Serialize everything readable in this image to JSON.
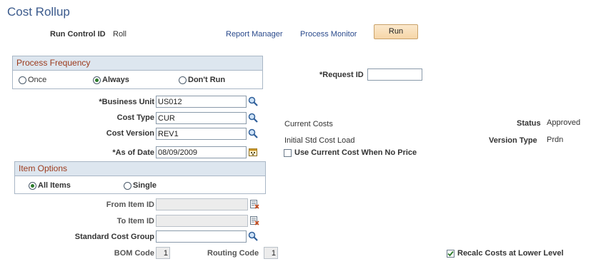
{
  "page": {
    "title": "Cost Rollup"
  },
  "header": {
    "run_control_label": "Run Control ID",
    "run_control_value": "Roll",
    "report_manager": "Report Manager",
    "process_monitor": "Process Monitor",
    "run_button": "Run"
  },
  "process_frequency": {
    "title": "Process Frequency",
    "options": [
      "Once",
      "Always",
      "Don't Run"
    ],
    "selected": "Always"
  },
  "request": {
    "label": "*Request ID",
    "value": ""
  },
  "fields": {
    "business_unit": {
      "label": "*Business Unit",
      "value": "US012"
    },
    "cost_type": {
      "label": "Cost Type",
      "value": "CUR",
      "desc": "Current Costs"
    },
    "cost_version": {
      "label": "Cost Version",
      "value": "REV1",
      "desc": "Initial Std Cost Load"
    },
    "as_of_date": {
      "label": "*As of Date",
      "value": "08/09/2009"
    }
  },
  "status": {
    "label": "Status",
    "value": "Approved"
  },
  "version_type": {
    "label": "Version Type",
    "value": "Prdn"
  },
  "use_current_cost": {
    "label": "Use Current Cost When No Price",
    "checked": false
  },
  "item_options": {
    "title": "Item Options",
    "options": [
      "All Items",
      "Single"
    ],
    "selected": "All Items"
  },
  "item_fields": {
    "from_item": {
      "label": "From Item ID",
      "value": ""
    },
    "to_item": {
      "label": "To Item ID",
      "value": ""
    },
    "std_cost_group": {
      "label": "Standard Cost Group",
      "value": ""
    },
    "bom_code": {
      "label": "BOM Code",
      "value": "1"
    },
    "routing_code": {
      "label": "Routing Code",
      "value": "1"
    }
  },
  "recalc": {
    "label": "Recalc Costs at Lower Level",
    "checked": true
  },
  "icons": {
    "lookup": "magnifier-icon",
    "calendar": "calendar-icon",
    "item_lookup": "item-lookup-icon"
  }
}
